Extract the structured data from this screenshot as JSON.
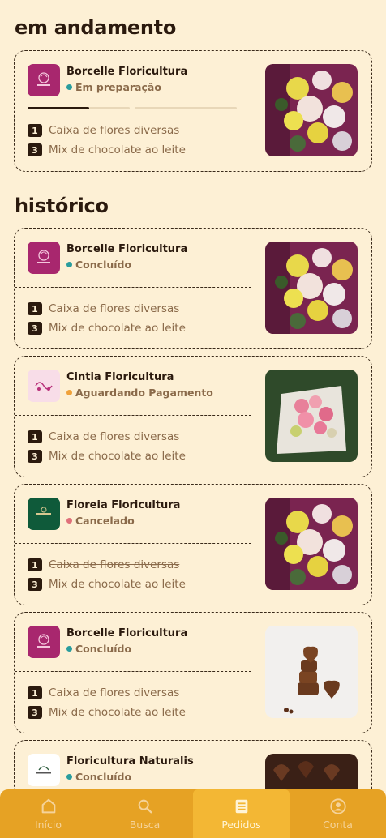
{
  "sections": {
    "ongoing_title": "em andamento",
    "history_title": "histórico"
  },
  "ongoing": [
    {
      "shop": "Borcelle Floricultura",
      "status": "Em preparação",
      "status_color": "#2a9d9d",
      "progress": 0.3,
      "items": [
        {
          "qty": "1",
          "name": "Caixa de flores diversas"
        },
        {
          "qty": "3",
          "name": "Mix de chocolate ao leite"
        }
      ],
      "logo": "borcelle",
      "photo": "flowers-box"
    }
  ],
  "history": [
    {
      "shop": "Borcelle Floricultura",
      "status": "Concluído",
      "status_color": "#2a9d9d",
      "items": [
        {
          "qty": "1",
          "name": "Caixa de flores diversas"
        },
        {
          "qty": "3",
          "name": "Mix de chocolate ao leite"
        }
      ],
      "logo": "borcelle",
      "photo": "flowers-box"
    },
    {
      "shop": "Cintia Floricultura",
      "status": "Aguardando Pagamento",
      "status_color": "#f0a23a",
      "items": [
        {
          "qty": "1",
          "name": "Caixa de flores diversas"
        },
        {
          "qty": "3",
          "name": "Mix de chocolate ao leite"
        }
      ],
      "logo": "cintia",
      "photo": "pink-bouquet"
    },
    {
      "shop": "Floreia Floricultura",
      "status": "Cancelado",
      "status_color": "#e0707a",
      "cancelled": true,
      "items": [
        {
          "qty": "1",
          "name": "Caixa de flores diversas"
        },
        {
          "qty": "3",
          "name": "Mix de chocolate ao leite"
        }
      ],
      "logo": "floreia",
      "photo": "flowers-box"
    },
    {
      "shop": "Borcelle Floricultura",
      "status": "Concluído",
      "status_color": "#2a9d9d",
      "items": [
        {
          "qty": "1",
          "name": "Caixa de flores diversas"
        },
        {
          "qty": "3",
          "name": "Mix de chocolate ao leite"
        }
      ],
      "logo": "borcelle",
      "photo": "chocolate-hearts"
    },
    {
      "shop": "Floricultura Naturalis",
      "status": "Concluído",
      "status_color": "#2a9d9d",
      "items": [],
      "logo": "naturalis",
      "photo": "chocolate-box"
    }
  ],
  "nav": [
    {
      "label": "Início",
      "icon": "home-icon",
      "active": false
    },
    {
      "label": "Busca",
      "icon": "search-icon",
      "active": false
    },
    {
      "label": "Pedidos",
      "icon": "orders-icon",
      "active": true
    },
    {
      "label": "Conta",
      "icon": "account-icon",
      "active": false
    }
  ],
  "colors": {
    "background": "#fdf0d5",
    "text": "#2b1a0e",
    "muted": "#8a6a4a",
    "nav": "#e6a224",
    "nav_active": "#f3b734"
  }
}
